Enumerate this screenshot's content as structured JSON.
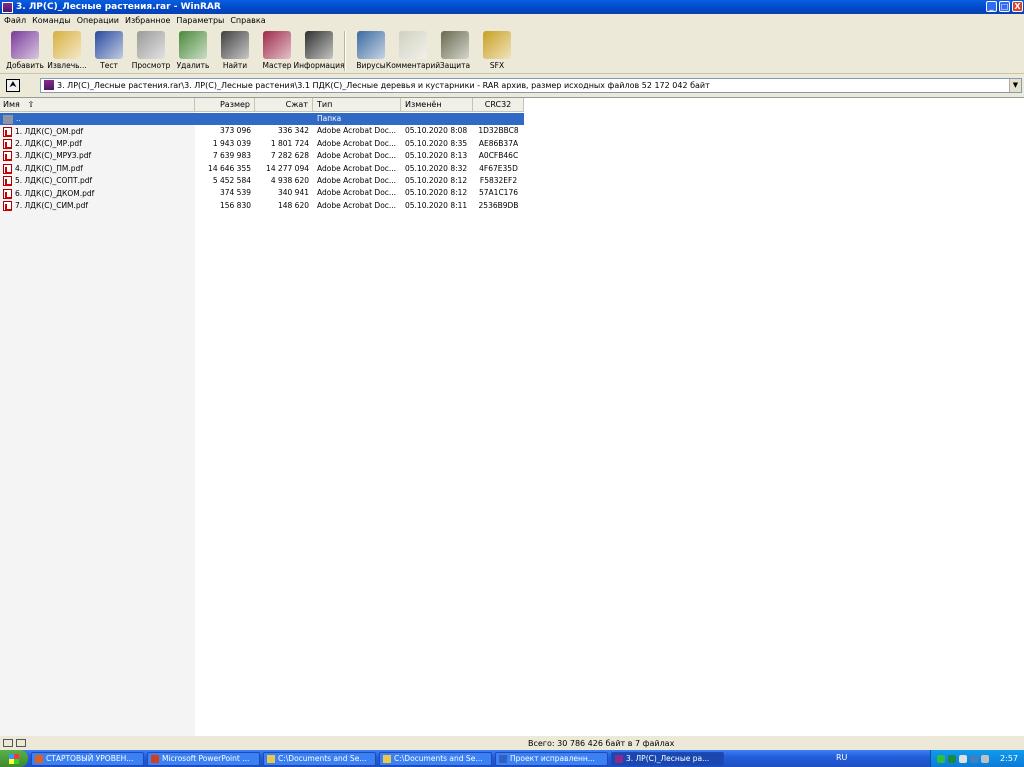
{
  "window": {
    "title": "3. ЛР(С)_Лесные растения.rar - WinRAR",
    "buttons": [
      "_",
      "□",
      "X"
    ]
  },
  "menu": [
    "Файл",
    "Команды",
    "Операции",
    "Избранное",
    "Параметры",
    "Справка"
  ],
  "toolbar": [
    {
      "label": "Добавить",
      "icon": "add-archive-icon",
      "color": "#7a3a9a"
    },
    {
      "label": "Извлечь...",
      "icon": "extract-icon",
      "color": "#d8b040"
    },
    {
      "label": "Тест",
      "icon": "test-icon",
      "color": "#2a4aa0"
    },
    {
      "label": "Просмотр",
      "icon": "view-icon",
      "color": "#9a9a9a"
    },
    {
      "label": "Удалить",
      "icon": "delete-icon",
      "color": "#4a8a3a"
    },
    {
      "label": "Найти",
      "icon": "find-binoculars-icon",
      "color": "#404040"
    },
    {
      "label": "Мастер",
      "icon": "wizard-icon",
      "color": "#a02a4a"
    },
    {
      "label": "Информация",
      "icon": "info-icon",
      "color": "#303030"
    },
    {
      "label": "Вирусы",
      "icon": "virus-scan-icon",
      "color": "#3a6aa0"
    },
    {
      "label": "Комментарий",
      "icon": "comment-icon",
      "color": "#d0d0c0"
    },
    {
      "label": "Защита",
      "icon": "protect-shield-icon",
      "color": "#6a6a50"
    },
    {
      "label": "SFX",
      "icon": "sfx-icon",
      "color": "#c8a020"
    }
  ],
  "pathbar": {
    "up_symbol": "⮝",
    "dropdown_symbol": "▼",
    "path": "3. ЛР(С)_Лесные растения.rar\\3. ЛР(С)_Лесные растения\\3.1 ПДК(С)_Лесные деревья и кустарники - RAR архив, размер исходных файлов 52 172 042 байт"
  },
  "columns": {
    "name": "Имя",
    "sort_symbol": "⇧",
    "size": "Размер",
    "packed": "Сжат",
    "type": "Тип",
    "modified": "Изменён",
    "crc": "CRC32"
  },
  "parent_row": {
    "name": "..",
    "type": "Папка"
  },
  "files": [
    {
      "name": "1. ЛДК(С)_ОМ.pdf",
      "size": "373 096",
      "packed": "336 342",
      "type": "Adobe Acrobat Doc...",
      "modified": "05.10.2020 8:08",
      "crc": "1D32BBC8"
    },
    {
      "name": "2. ЛДК(С)_МР.pdf",
      "size": "1 943 039",
      "packed": "1 801 724",
      "type": "Adobe Acrobat Doc...",
      "modified": "05.10.2020 8:35",
      "crc": "AE86B37A"
    },
    {
      "name": "3. ЛДК(С)_МРУЗ.pdf",
      "size": "7 639 983",
      "packed": "7 282 628",
      "type": "Adobe Acrobat Doc...",
      "modified": "05.10.2020 8:13",
      "crc": "A0CFB46C"
    },
    {
      "name": "4. ЛДК(С)_ПМ.pdf",
      "size": "14 646 355",
      "packed": "14 277 094",
      "type": "Adobe Acrobat Doc...",
      "modified": "05.10.2020 8:32",
      "crc": "4F67E35D"
    },
    {
      "name": "5. ЛДК(С)_СОПТ.pdf",
      "size": "5 452 584",
      "packed": "4 938 620",
      "type": "Adobe Acrobat Doc...",
      "modified": "05.10.2020 8:12",
      "crc": "F5832EF2"
    },
    {
      "name": "6. ЛДК(С)_ДКОМ.pdf",
      "size": "374 539",
      "packed": "340 941",
      "type": "Adobe Acrobat Doc...",
      "modified": "05.10.2020 8:12",
      "crc": "57A1C176"
    },
    {
      "name": "7. ЛДК(С)_СИМ.pdf",
      "size": "156 830",
      "packed": "148 620",
      "type": "Adobe Acrobat Doc...",
      "modified": "05.10.2020 8:11",
      "crc": "2536B9DB"
    }
  ],
  "status": {
    "text": "Всего: 30 786 426 байт в 7 файлах"
  },
  "taskbar": {
    "tasks": [
      {
        "label": "СТАРТОВЫЙ УРОВЕН...",
        "color": "#e06020"
      },
      {
        "label": "Microsoft PowerPoint ...",
        "color": "#d04020"
      },
      {
        "label": "C:\\Documents and Se...",
        "color": "#e8c850"
      },
      {
        "label": "C:\\Documents and Se...",
        "color": "#e8c850"
      },
      {
        "label": "Проект исправленн...",
        "color": "#3060c0"
      },
      {
        "label": "3. ЛР(С)_Лесные ра...",
        "color": "#8a2a8a"
      }
    ],
    "language": "RU",
    "clock": "2:57"
  }
}
